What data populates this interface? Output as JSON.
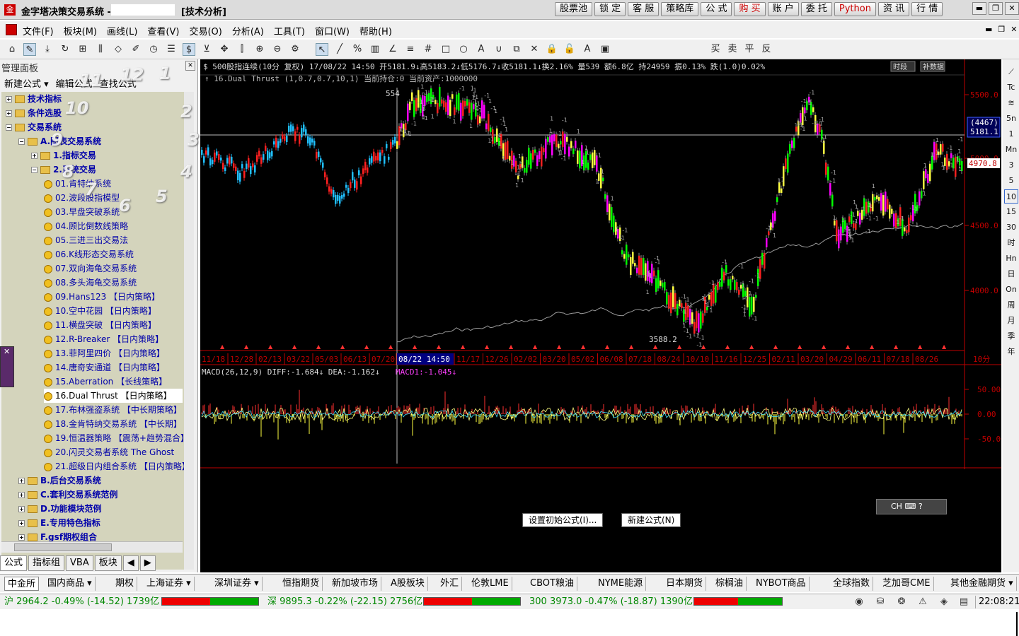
{
  "window": {
    "app_title": "金字塔决策交易系统 -",
    "title_suffix": "[技术分析]",
    "quick_buttons": [
      "股票池",
      "锁 定",
      "客 服",
      "策略库",
      "公 式",
      "购 买",
      "账 户",
      "委 托",
      "Python",
      "资 讯",
      "行 情"
    ],
    "win_controls": [
      "▬",
      "❐",
      "✕"
    ]
  },
  "menubar": {
    "items": [
      "文件(F)",
      "板块(M)",
      "画线(L)",
      "查看(V)",
      "交易(O)",
      "分析(A)",
      "工具(T)",
      "窗口(W)",
      "帮助(H)"
    ],
    "mdi_controls": [
      "▬",
      "❐",
      "✕"
    ]
  },
  "toolbar": {
    "icons": [
      "home-icon",
      "pencil-icon",
      "download-icon",
      "refresh-icon",
      "grid-icon",
      "candles-icon",
      "diamond-icon",
      "edit-icon",
      "clock-icon",
      "list-icon",
      "dollar-icon",
      "filter-icon",
      "move-icon",
      "column-icon",
      "zoom-in-icon",
      "zoom-out-icon",
      "gear-icon",
      "pointer-icon",
      "line-icon",
      "percent-icon",
      "fib-icon",
      "angle-icon",
      "hlines-icon",
      "hash-icon",
      "rect-icon",
      "circle-icon",
      "text-icon",
      "magnet-icon",
      "copy-icon",
      "delete-icon",
      "lock-icon",
      "lock2-icon",
      "color-icon",
      "save-icon"
    ],
    "glyphs": [
      "⌂",
      "✎",
      "⤓",
      "↻",
      "⊞",
      "⫼",
      "◇",
      "✐",
      "◷",
      "☰",
      "$",
      "⊻",
      "✥",
      "⫿",
      "⊕",
      "⊖",
      "⚙",
      "↖",
      "╱",
      "%",
      "▥",
      "∠",
      "≡",
      "#",
      "□",
      "○",
      "A",
      "∪",
      "⧉",
      "✕",
      "🔒",
      "🔓",
      "A",
      "▣"
    ],
    "trade_labels": [
      "买",
      "卖",
      "平",
      "反"
    ]
  },
  "sidebar": {
    "title": "管理面板",
    "hide_label": "✕",
    "actions": [
      "新建公式 ▾",
      "编辑公式",
      "查找公式"
    ],
    "tree": [
      {
        "label": "技术指标",
        "level": 0,
        "kind": "folder",
        "exp": "+"
      },
      {
        "label": "条件选股",
        "level": 0,
        "kind": "folder",
        "exp": "+"
      },
      {
        "label": "交易系统",
        "level": 0,
        "kind": "folder",
        "exp": "−"
      },
      {
        "label": "A.图表交易系统",
        "level": 1,
        "kind": "folder",
        "exp": "−"
      },
      {
        "label": "1.指标交易",
        "level": 2,
        "kind": "folder",
        "exp": "+"
      },
      {
        "label": "2.系统交易",
        "level": 2,
        "kind": "folder",
        "exp": "−"
      },
      {
        "label": "01.肯特纳系统",
        "level": 3,
        "kind": "item"
      },
      {
        "label": "02.波段股指模型",
        "level": 3,
        "kind": "item"
      },
      {
        "label": "03.早盘突破系统",
        "level": 3,
        "kind": "item"
      },
      {
        "label": "04.顾比倒数线策略",
        "level": 3,
        "kind": "item"
      },
      {
        "label": "05.三进三出交易法",
        "level": 3,
        "kind": "item"
      },
      {
        "label": "06.K线形态交易系统",
        "level": 3,
        "kind": "item"
      },
      {
        "label": "07.双向海龟交易系统",
        "level": 3,
        "kind": "item"
      },
      {
        "label": "08.多头海龟交易系统",
        "level": 3,
        "kind": "item"
      },
      {
        "label": "09.Hans123 【日内策略】",
        "level": 3,
        "kind": "item"
      },
      {
        "label": "10.空中花园 【日内策略】",
        "level": 3,
        "kind": "item"
      },
      {
        "label": "11.横盘突破 【日内策略】",
        "level": 3,
        "kind": "item"
      },
      {
        "label": "12.R-Breaker 【日内策略】",
        "level": 3,
        "kind": "item"
      },
      {
        "label": "13.菲阿里四价 【日内策略】",
        "level": 3,
        "kind": "item"
      },
      {
        "label": "14.唐奇安通道 【日内策略】",
        "level": 3,
        "kind": "item"
      },
      {
        "label": "15.Aberration 【长线策略】",
        "level": 3,
        "kind": "item"
      },
      {
        "label": "16.Dual Thrust 【日内策略】",
        "level": 3,
        "kind": "item",
        "selected": true
      },
      {
        "label": "17.布林强盗系统 【中长期策略】",
        "level": 3,
        "kind": "item"
      },
      {
        "label": "18.金肯特纳交易系统 【中长期】",
        "level": 3,
        "kind": "item"
      },
      {
        "label": "19.恒温器策略 【震荡+趋势混合】",
        "level": 3,
        "kind": "item"
      },
      {
        "label": "20.闪灵交易者系统 The Ghost",
        "level": 3,
        "kind": "item"
      },
      {
        "label": "21.超级日内组合系统 【日内策略】",
        "level": 3,
        "kind": "item"
      },
      {
        "label": "B.后台交易系统",
        "level": 1,
        "kind": "folder",
        "exp": "+"
      },
      {
        "label": "C.套利交易系统范例",
        "level": 1,
        "kind": "folder",
        "exp": "+"
      },
      {
        "label": "D.功能模块范例",
        "level": 1,
        "kind": "folder",
        "exp": "+"
      },
      {
        "label": "E.专用特色指标",
        "level": 1,
        "kind": "folder",
        "exp": "+"
      },
      {
        "label": "F.gsf期权组合",
        "level": 1,
        "kind": "folder",
        "exp": "+"
      }
    ],
    "tabs": [
      "公式",
      "指标组",
      "VBA",
      "板块"
    ],
    "tab_arrows": [
      "◀",
      "▶"
    ]
  },
  "chart": {
    "header": "$ 500股指连续(10分 复权) 17/08/22 14:50 开5181.9↓高5183.2↓低5176.7↓收5181.1↓换2.16% 量539 额6.8亿 持24959 振0.13% 跌(1.0)0.02%",
    "strategy_line": "↑ 16.Dual Thrust (1,0.7,0.7,10,1) 当前持仓:0 当前资产:1000000",
    "header_buttons": [
      "时段",
      "补数据"
    ],
    "price_axis": [
      "5500.0",
      "5000.0",
      "4500.0",
      "4000.0"
    ],
    "current_price_labels": [
      "(4467)",
      "5181.1",
      "4970.8"
    ],
    "min_label": "3588.2",
    "max_label": "554",
    "date_axis": [
      "11/18",
      "12/28",
      "02/13",
      "03/22",
      "05/03",
      "06/13",
      "07/20",
      "08/22 14:50",
      "11/17",
      "12/26",
      "02/02",
      "03/20",
      "05/02",
      "06/08",
      "07/18",
      "08/24",
      "10/10",
      "11/16",
      "12/25",
      "02/11",
      "03/20",
      "04/29",
      "06/11",
      "07/18",
      "08/26"
    ],
    "period": "10分",
    "macd_header_1": "MACD(26,12,9) DIFF:-1.684↓ DEA:-1.162↓",
    "macd_header_2": "MACD1:-1.045↓",
    "macd_axis": [
      "50.00",
      "0.00",
      "-50.00"
    ],
    "button_set_initial": "设置初始公式(I)...",
    "button_new_formula": "新建公式(N)",
    "colors": {
      "up": "#ff2020",
      "down": "#20c0ff",
      "grid": "#c00000",
      "equity": "#9a9a9a",
      "macd_pos": "#ff3030",
      "macd_neg": "#ffff40",
      "candle_green": "#00ff00",
      "candle_mag": "#ff00ff"
    }
  },
  "right_toolbar": [
    "⟋",
    "Tc",
    "≋",
    "5n",
    "1",
    "Mn",
    "3",
    "5",
    "10",
    "15",
    "30",
    "时",
    "Hn",
    "日",
    "On",
    "周",
    "月",
    "季",
    "年"
  ],
  "ime": {
    "label": "CH ⌨ ?"
  },
  "market_tabs": [
    "中金所",
    "国内商品 ▾",
    "期权",
    "上海证券 ▾",
    "深圳证券 ▾",
    "恒指期货",
    "新加坡市场",
    "A股板块",
    "外汇",
    "伦敦LME",
    "CBOT粮油",
    "NYME能源",
    "日本期货",
    "棕榈油",
    "NYBOT商品",
    "全球指数",
    "芝加哥CME",
    "其他金融期货 ▾",
    "⚙ ▾"
  ],
  "status": {
    "sh": "沪 2964.2 -0.49% (-14.52) 1739亿",
    "sz": "深 9895.3 -0.22% (-22.15) 2756亿",
    "hs300": "300 3973.0 -0.47% (-18.87) 1390亿",
    "time": "22:08:21",
    "sh_up_ratio": 0.5,
    "sz_up_ratio": 0.5,
    "hs300_up_ratio": 0.5
  },
  "overlay_numbers": [
    "1",
    "2",
    "3",
    "4",
    "5",
    "6",
    "7",
    "8",
    "9",
    "10",
    "11",
    "12"
  ]
}
